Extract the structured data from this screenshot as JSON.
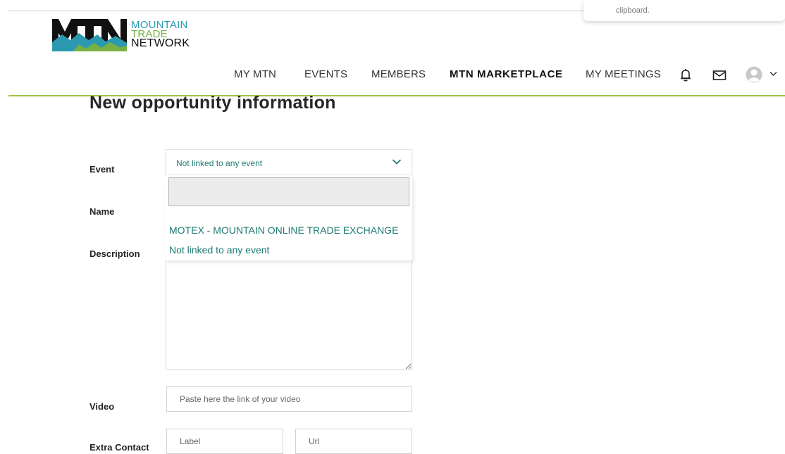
{
  "toast": {
    "text": "clipboard."
  },
  "logo": {
    "line1": "MOUNTAIN",
    "line2": "TRADE",
    "line3": "NETWORK"
  },
  "nav": {
    "items": [
      {
        "label": "MY MTN"
      },
      {
        "label": "EVENTS"
      },
      {
        "label": "MEMBERS"
      },
      {
        "label": "MTN MARKETPLACE"
      },
      {
        "label": "MY MEETINGS"
      }
    ],
    "icons": [
      "bell-icon",
      "mail-icon",
      "avatar-icon",
      "chevron-down-icon"
    ]
  },
  "page": {
    "title": "New opportunity information"
  },
  "form": {
    "event": {
      "label": "Event",
      "selected": "Not linked to any event",
      "options": [
        "MOTEX - MOUNTAIN ONLINE TRADE EXCHANGE",
        "Not linked to any event"
      ]
    },
    "name": {
      "label": "Name"
    },
    "description": {
      "label": "Description"
    },
    "video": {
      "label": "Video",
      "placeholder": "Paste here the link of your video"
    },
    "extra_contact": {
      "label": "Extra Contact",
      "label_placeholder": "Label",
      "url_placeholder": "Url"
    }
  },
  "colors": {
    "accent_green": "#9fc04a",
    "teal_link": "#1d7b73",
    "logo_blue": "#2b9ab0",
    "logo_green": "#79b043"
  }
}
